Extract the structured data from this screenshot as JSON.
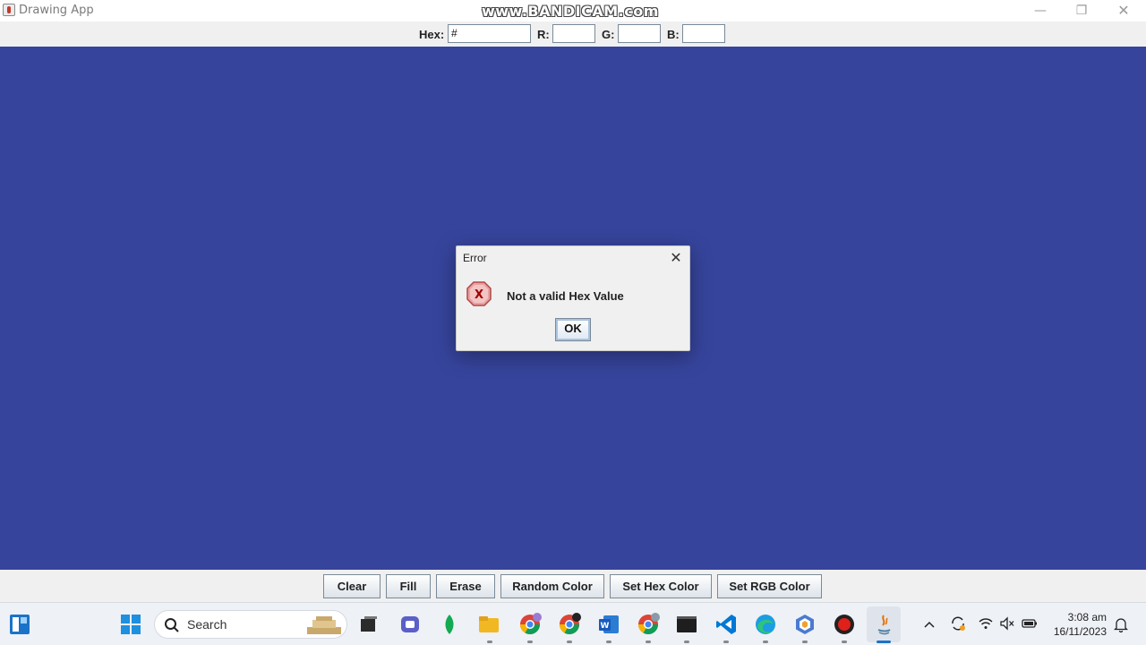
{
  "window": {
    "title": "Drawing App",
    "watermark": "www.BANDICAM.com",
    "minimize_glyph": "—",
    "maximize_glyph": "❐",
    "close_glyph": "✕"
  },
  "color_inputs": {
    "hex_label": "Hex:",
    "hex_value": "#",
    "r_label": "R:",
    "r_value": "",
    "g_label": "G:",
    "g_value": "",
    "b_label": "B:",
    "b_value": ""
  },
  "canvas": {
    "background_color": "#36449c"
  },
  "dialog": {
    "title": "Error",
    "close_glyph": "✕",
    "message": "Not a valid Hex Value",
    "ok_label": "OK",
    "icon": "error-icon"
  },
  "toolbar": {
    "buttons": [
      "Clear",
      "Fill",
      "Erase",
      "Random Color",
      "Set Hex Color",
      "Set RGB Color"
    ]
  },
  "taskbar": {
    "search_placeholder": "Search",
    "time": "3:08 am",
    "date": "16/11/2023",
    "apps": [
      "widgets-icon",
      "start-icon",
      "file-explorer-icon",
      "teams-icon",
      "mongodb-icon",
      "folder-icon",
      "chrome-icon",
      "chrome-icon",
      "word-icon",
      "chrome-icon",
      "terminal-icon",
      "vscode-icon",
      "edge-icon",
      "app-icon",
      "record-icon",
      "java-icon"
    ]
  }
}
